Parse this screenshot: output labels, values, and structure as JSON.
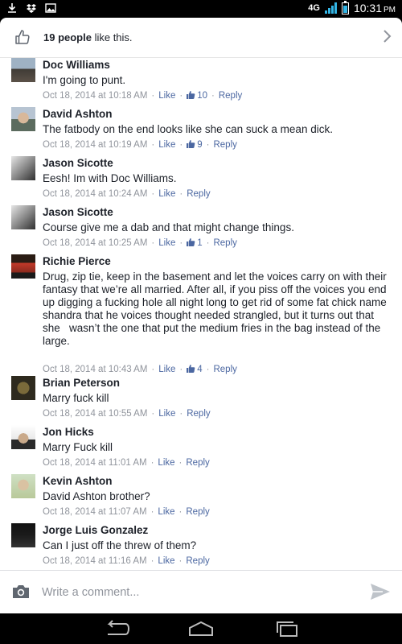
{
  "status_bar": {
    "network_label": "4G",
    "time": "10:31",
    "time_suffix": "PM",
    "accent_color": "#33b5e5"
  },
  "likes": {
    "count": "19 people",
    "suffix": " like this.",
    "icon": "thumbs-up-outline-icon"
  },
  "comments": [
    {
      "author": "Doc Williams",
      "text": "I'm going to punt.",
      "timestamp": "Oct 18, 2014 at 10:18 AM",
      "like_label": "Like",
      "like_count": "10",
      "reply_label": "Reply"
    },
    {
      "author": "David Ashton",
      "text": "The fatbody on the end looks like she can suck a mean dick.",
      "timestamp": "Oct 18, 2014 at 10:19 AM",
      "like_label": "Like",
      "like_count": "9",
      "reply_label": "Reply"
    },
    {
      "author": "Jason Sicotte",
      "text": "Eesh! Im with Doc Williams.",
      "timestamp": "Oct 18, 2014 at 10:24 AM",
      "like_label": "Like",
      "like_count": null,
      "reply_label": "Reply"
    },
    {
      "author": "Jason Sicotte",
      "text": "Course give me a dab and that might change things.",
      "timestamp": "Oct 18, 2014 at 10:25 AM",
      "like_label": "Like",
      "like_count": "1",
      "reply_label": "Reply"
    },
    {
      "author": "Richie Pierce",
      "text": "Drug, zip tie, keep in the basement and let the voices carry on with their fantasy that we’re all married. After all, if you piss off the voices you end up digging a fucking hole all night long to get rid of some fat chick name shandra that he voices thought needed strangled, but it turns out that she   wasn’t the one that put the medium fries in the bag instead of the large.",
      "timestamp": "Oct 18, 2014 at 10:43 AM",
      "like_label": "Like",
      "like_count": "4",
      "reply_label": "Reply"
    },
    {
      "author": "Brian Peterson",
      "text": "Marry fuck kill",
      "timestamp": "Oct 18, 2014 at 10:55 AM",
      "like_label": "Like",
      "like_count": null,
      "reply_label": "Reply"
    },
    {
      "author": "Jon Hicks",
      "text": "Marry Fuck kill",
      "timestamp": "Oct 18, 2014 at 11:01 AM",
      "like_label": "Like",
      "like_count": null,
      "reply_label": "Reply"
    },
    {
      "author": "Kevin Ashton",
      "text": "David Ashton brother?",
      "timestamp": "Oct 18, 2014 at 11:07 AM",
      "like_label": "Like",
      "like_count": null,
      "reply_label": "Reply"
    },
    {
      "author": "Jorge Luis Gonzalez",
      "text": "Can I just off the threw of them?",
      "timestamp": "Oct 18, 2014 at 11:16 AM",
      "like_label": "Like",
      "like_count": null,
      "reply_label": "Reply"
    }
  ],
  "composer": {
    "placeholder": "Write a comment...",
    "camera_icon": "camera-icon",
    "send_icon": "send-icon"
  },
  "nav": {
    "back_icon": "back-icon",
    "home_icon": "home-icon",
    "recents_icon": "recent-apps-icon"
  }
}
